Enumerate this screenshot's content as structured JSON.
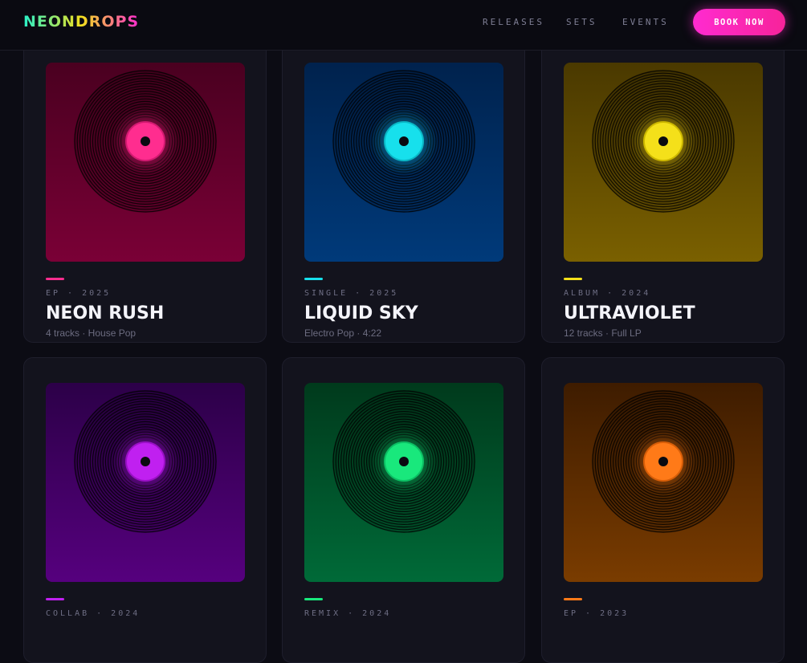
{
  "brand": "NEONDROPS",
  "nav": [
    {
      "label": "RELEASES"
    },
    {
      "label": "SETS"
    },
    {
      "label": "EVENTS"
    }
  ],
  "cta": {
    "label": "BOOK NOW"
  },
  "releases": [
    {
      "type": "EP",
      "year": "2025",
      "meta": "EP · 2025",
      "title": "NEON RUSH",
      "subtitle": "4 tracks · House Pop",
      "accent": "#ff2d8f",
      "cover_top": "#4a0020",
      "cover_bottom": "#7a0036",
      "label_color": "#ff2d8f",
      "label_dark": "#d41a72"
    },
    {
      "type": "SINGLE",
      "year": "2025",
      "meta": "SINGLE · 2025",
      "title": "LIQUID SKY",
      "subtitle": "Electro Pop · 4:22",
      "accent": "#17e0ec",
      "cover_top": "#00224d",
      "cover_bottom": "#003a7a",
      "label_color": "#17e0ec",
      "label_dark": "#0ab8c6"
    },
    {
      "type": "ALBUM",
      "year": "2024",
      "meta": "ALBUM · 2024",
      "title": "ULTRAVIOLET",
      "subtitle": "12 tracks · Full LP",
      "accent": "#f4e01a",
      "cover_top": "#4a3900",
      "cover_bottom": "#7a6000",
      "label_color": "#f4e01a",
      "label_dark": "#cdb800"
    },
    {
      "type": "COLLAB",
      "year": "2024",
      "meta": "COLLAB · 2024",
      "title": "",
      "subtitle": "",
      "accent": "#c020f0",
      "cover_top": "#2c0048",
      "cover_bottom": "#56007e",
      "label_color": "#c020f0",
      "label_dark": "#9a10c6"
    },
    {
      "type": "REMIX",
      "year": "2024",
      "meta": "REMIX · 2024",
      "title": "",
      "subtitle": "",
      "accent": "#19e87c",
      "cover_top": "#003a1c",
      "cover_bottom": "#006a38",
      "label_color": "#19e87c",
      "label_dark": "#0cc064"
    },
    {
      "type": "EP",
      "year": "2023",
      "meta": "EP · 2023",
      "title": "",
      "subtitle": "",
      "accent": "#ff7a18",
      "cover_top": "#3e1c00",
      "cover_bottom": "#7a3c00",
      "label_color": "#ff7a18",
      "label_dark": "#d85e08"
    }
  ]
}
